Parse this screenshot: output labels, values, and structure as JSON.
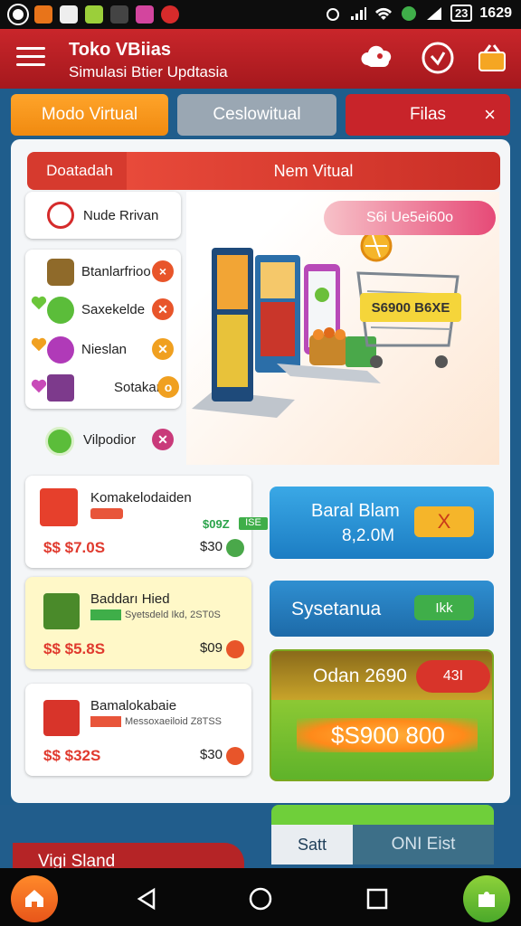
{
  "status_bar": {
    "time": "1629",
    "battery": "23"
  },
  "header": {
    "title": "Toko VBiias",
    "subtitle": "Simulasi Btier Updtasia"
  },
  "tabs": [
    {
      "label": "Modo Virtual"
    },
    {
      "label": "Ceslowitual"
    },
    {
      "label": "Filas"
    }
  ],
  "tab_close": "×",
  "section_tabs": {
    "left": "Doatadah",
    "right": "Nem Vitual"
  },
  "menu": {
    "top_item": "Nude Rrivan",
    "items": [
      {
        "label": "Btanlarfrioo",
        "badge": "×"
      },
      {
        "label": "Saxekelde",
        "badge": "✕"
      },
      {
        "label": "Nieslan",
        "badge": "✕"
      },
      {
        "label": "Sotakan",
        "badge": "o"
      }
    ],
    "bottom_item": "Vilpodior",
    "bottom_badge": "✕"
  },
  "hero": {
    "promo": "S6i Ue5ei60o",
    "price_tag": "S6900 B6XE"
  },
  "products": [
    {
      "name": "Komakelodaiden",
      "price": "$$ $7.0S",
      "small_price": "$30",
      "badge_price": "$09Z",
      "green_tag": "ISE"
    },
    {
      "name": "Baddarı Hied",
      "sub": "Syetsdeld Ikd, 2ST0S",
      "price": "$$ $5.8S",
      "small_price": "$09"
    },
    {
      "name": "Bamalokabaie",
      "sub": "Messoxaeiloid Z8TSS",
      "price": "$$ $32S",
      "small_price": "$30"
    }
  ],
  "tiles": {
    "blue_title": "Baral Blam",
    "blue_value": "8,2.0M",
    "blue_btn": "X",
    "blue2_title": "Sysetanua",
    "blue2_btn": "Ikk",
    "green_title": "Odan 2690",
    "green_badge": "43I",
    "green_value": "$S900 800"
  },
  "bottom": {
    "left": "Vigi Sland",
    "mid": "Satt",
    "right": "ONI Eist"
  }
}
